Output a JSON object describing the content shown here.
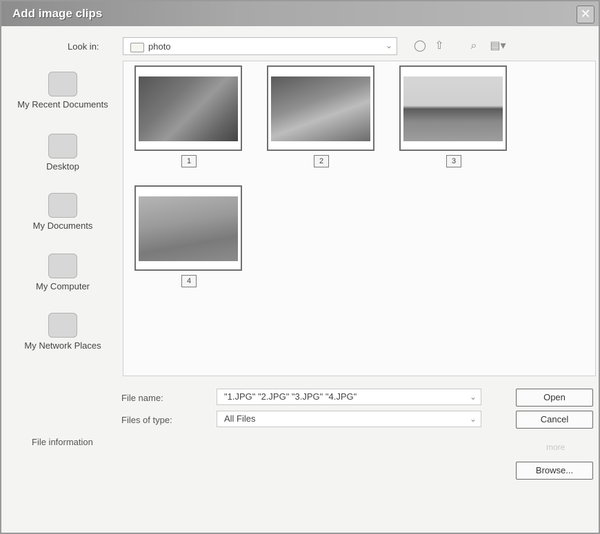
{
  "window": {
    "title": "Add image clips",
    "close_glyph": "✕"
  },
  "lookin": {
    "label": "Look in:",
    "value": "photo",
    "arrow": "⌄"
  },
  "toolbar": {
    "back_glyph": "◯",
    "up_glyph": "⇧",
    "search_glyph": "⌕",
    "views_glyph": "▤▾"
  },
  "places": [
    {
      "label": "My Recent Documents"
    },
    {
      "label": "Desktop"
    },
    {
      "label": "My Documents"
    },
    {
      "label": "My Computer"
    },
    {
      "label": "My Network Places"
    }
  ],
  "files": [
    {
      "caption": "1"
    },
    {
      "caption": "2"
    },
    {
      "caption": "3"
    },
    {
      "caption": "4"
    }
  ],
  "filename": {
    "label": "File name:",
    "value": "\"1.JPG\" \"2.JPG\" \"3.JPG\" \"4.JPG\"",
    "arrow": "⌄"
  },
  "filetype": {
    "label": "Files of type:",
    "value": "All Files",
    "arrow": "⌄"
  },
  "fileinfo": {
    "label": "File information"
  },
  "buttons": {
    "open": "Open",
    "cancel": "Cancel",
    "more": "more",
    "browse": "Browse..."
  }
}
